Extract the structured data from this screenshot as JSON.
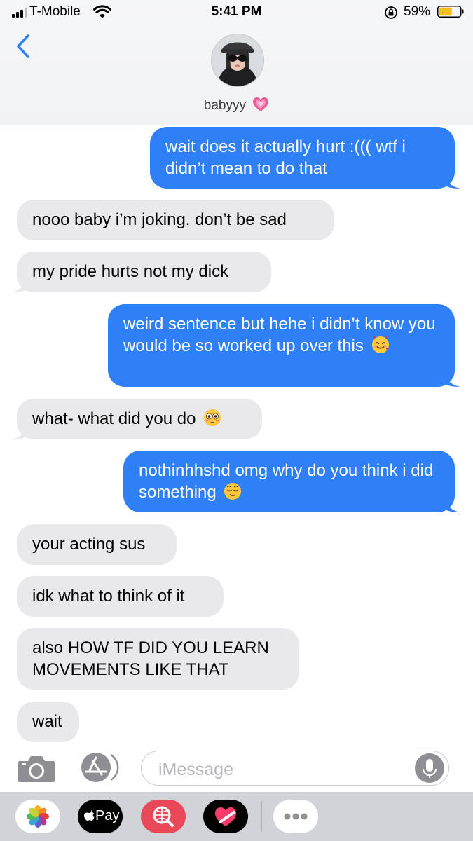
{
  "status": {
    "carrier": "T-Mobile",
    "time": "5:41 PM",
    "battery": "59%"
  },
  "contact": {
    "name": "babyyy"
  },
  "messages": [
    {
      "dir": "out",
      "text": "wait does it actually hurt :((( wtf i didn’t mean to do that"
    },
    {
      "dir": "in",
      "text": "nooo baby i’m joking. don’t be sad"
    },
    {
      "dir": "in",
      "text": "my pride hurts not my dick"
    },
    {
      "dir": "out",
      "text": "weird sentence but hehe i didn’t know you would be so worked up over this"
    },
    {
      "dir": "in",
      "text": "what- what did you do"
    },
    {
      "dir": "out",
      "text": "nothinhhshd omg why do you think i did something"
    },
    {
      "dir": "in",
      "text": "your acting sus"
    },
    {
      "dir": "in",
      "text": "idk what to think of it"
    },
    {
      "dir": "in",
      "text": "also HOW TF DID YOU LEARN MOVEMENTS LIKE THAT"
    },
    {
      "dir": "in",
      "text": "wait"
    }
  ],
  "compose": {
    "placeholder": "iMessage"
  },
  "drawer": {
    "applepay_label": "Pay"
  },
  "colors": {
    "outgoing": "#2f80f6",
    "incoming": "#e9e9eb",
    "accent": "#2f80f6"
  },
  "icons": [
    "signal-icon",
    "wifi-icon",
    "rotation-lock-icon",
    "battery-icon",
    "back-chevron-icon",
    "camera-icon",
    "app-store-icon",
    "microphone-icon",
    "photos-app-icon",
    "apple-pay-icon",
    "web-images-icon",
    "digital-touch-icon",
    "more-apps-icon"
  ]
}
